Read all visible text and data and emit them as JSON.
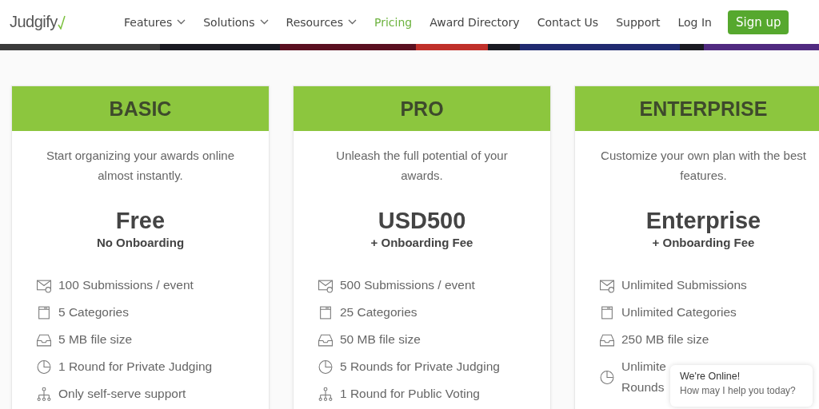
{
  "header": {
    "logo": "Judgify",
    "nav": [
      {
        "label": "Features",
        "dropdown": true,
        "selected": false
      },
      {
        "label": "Solutions",
        "dropdown": true,
        "selected": false
      },
      {
        "label": "Resources",
        "dropdown": true,
        "selected": false
      },
      {
        "label": "Pricing",
        "dropdown": false,
        "selected": true
      },
      {
        "label": "Award Directory",
        "dropdown": false,
        "selected": false
      },
      {
        "label": "Contact Us",
        "dropdown": false,
        "selected": false
      },
      {
        "label": "Support",
        "dropdown": false,
        "selected": false
      },
      {
        "label": "Log In",
        "dropdown": false,
        "selected": false
      }
    ],
    "cta": "Sign up"
  },
  "plans": [
    {
      "name": "BASIC",
      "description": "Start organizing your awards online almost instantly.",
      "price": "Free",
      "price_note": "No Onboarding",
      "features": [
        {
          "kind": "submissions",
          "lines": [
            "100 Submissions / event"
          ]
        },
        {
          "kind": "categories",
          "lines": [
            "5 Categories"
          ]
        },
        {
          "kind": "filesize",
          "lines": [
            "5 MB file size"
          ]
        },
        {
          "kind": "rounds",
          "lines": [
            "1 Round for Private Judging"
          ]
        },
        {
          "kind": "support",
          "lines": [
            "Only self-serve support"
          ]
        }
      ]
    },
    {
      "name": "PRO",
      "description": "Unleash the full potential of your awards.",
      "price": "USD500",
      "price_note": "+ Onboarding Fee",
      "features": [
        {
          "kind": "submissions",
          "lines": [
            "500 Submissions / event"
          ]
        },
        {
          "kind": "categories",
          "lines": [
            "25 Categories"
          ]
        },
        {
          "kind": "filesize",
          "lines": [
            "50 MB file size"
          ]
        },
        {
          "kind": "rounds",
          "lines": [
            "5 Rounds for Private Judging"
          ]
        },
        {
          "kind": "support",
          "lines": [
            "1 Round for Public Voting"
          ]
        }
      ]
    },
    {
      "name": "ENTERPRISE",
      "description": "Customize your own plan with the best features.",
      "price": "Enterprise",
      "price_note": "+ Onboarding Fee",
      "features": [
        {
          "kind": "submissions",
          "lines": [
            "Unlimited Submissions"
          ]
        },
        {
          "kind": "categories",
          "lines": [
            "Unlimited Categories"
          ]
        },
        {
          "kind": "filesize",
          "lines": [
            "250 MB file size"
          ]
        },
        {
          "kind": "rounds",
          "lines": [
            "Unlimite",
            "Rounds"
          ]
        }
      ]
    }
  ],
  "chat": {
    "title": "We're Online!",
    "message": "How may I help you today?"
  }
}
